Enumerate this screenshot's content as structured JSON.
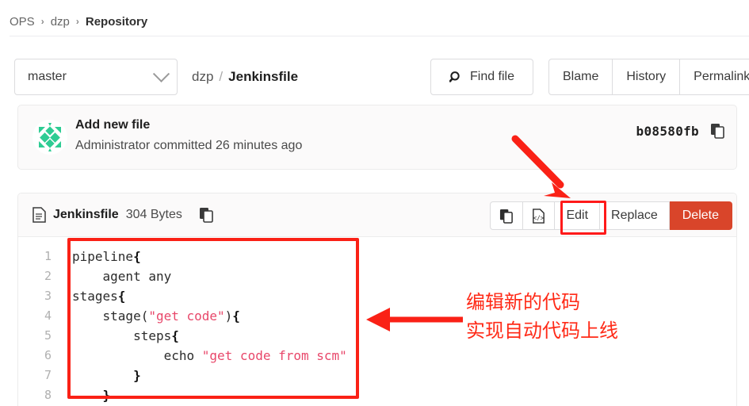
{
  "breadcrumb": {
    "items": [
      {
        "label": "OPS",
        "current": false
      },
      {
        "label": "dzp",
        "current": false
      },
      {
        "label": "Repository",
        "current": true
      }
    ],
    "separator": "›"
  },
  "toolbar": {
    "branch": "master",
    "project": "dzp",
    "path_separator": "/",
    "file_name": "Jenkinsfile",
    "find_file_label": "Find file",
    "find_file_icon": "search-icon",
    "chevron_icon": "chevron-down-icon",
    "actions": [
      {
        "label": "Blame"
      },
      {
        "label": "History"
      },
      {
        "label": "Permalink"
      }
    ]
  },
  "commit": {
    "avatar_icon": "identicon-avatar",
    "title": "Add new file",
    "subtitle": "Administrator committed 26 minutes ago",
    "sha": "b08580fb",
    "copy_icon": "copy-icon"
  },
  "file": {
    "file_icon": "document-icon",
    "name": "Jenkinsfile",
    "size": "304 Bytes",
    "copy_path_icon": "copy-icon",
    "actions": {
      "copy_icon": "copy-contents-icon",
      "code_icon": "code-view-icon",
      "edit_label": "Edit",
      "replace_label": "Replace",
      "delete_label": "Delete"
    }
  },
  "code": {
    "line_numbers": [
      "1",
      "2",
      "3",
      "4",
      "5",
      "6",
      "7",
      "8"
    ],
    "lines": [
      {
        "segments": [
          {
            "t": "pipeline",
            "c": "plain"
          },
          {
            "t": "{",
            "c": "brace"
          }
        ]
      },
      {
        "segments": [
          {
            "t": "    agent any",
            "c": "plain"
          }
        ]
      },
      {
        "segments": [
          {
            "t": "stages",
            "c": "plain"
          },
          {
            "t": "{",
            "c": "brace"
          }
        ]
      },
      {
        "segments": [
          {
            "t": "    stage(",
            "c": "plain"
          },
          {
            "t": "\"get code\"",
            "c": "string"
          },
          {
            "t": ")",
            "c": "plain"
          },
          {
            "t": "{",
            "c": "brace"
          }
        ]
      },
      {
        "segments": [
          {
            "t": "        steps",
            "c": "plain"
          },
          {
            "t": "{",
            "c": "brace"
          }
        ]
      },
      {
        "segments": [
          {
            "t": "            echo ",
            "c": "plain"
          },
          {
            "t": "\"get code from scm\"",
            "c": "string"
          }
        ]
      },
      {
        "segments": [
          {
            "t": "        ",
            "c": "plain"
          },
          {
            "t": "}",
            "c": "brace"
          }
        ]
      },
      {
        "segments": [
          {
            "t": "    ",
            "c": "plain"
          },
          {
            "t": "}",
            "c": "brace"
          }
        ]
      }
    ]
  },
  "annotations": {
    "note_line1": "编辑新的代码",
    "note_line2": "实现自动代码上线",
    "highlight_color": "#fa2116",
    "arrow_to_edit": "arrow-pointing-to-edit-button",
    "arrow_to_code": "arrow-pointing-to-code-block"
  },
  "colors": {
    "accent_red": "#fa2116",
    "delete_button": "#d9452a",
    "avatar_green": "#2ecc93",
    "string_literal": "#e8476a"
  }
}
